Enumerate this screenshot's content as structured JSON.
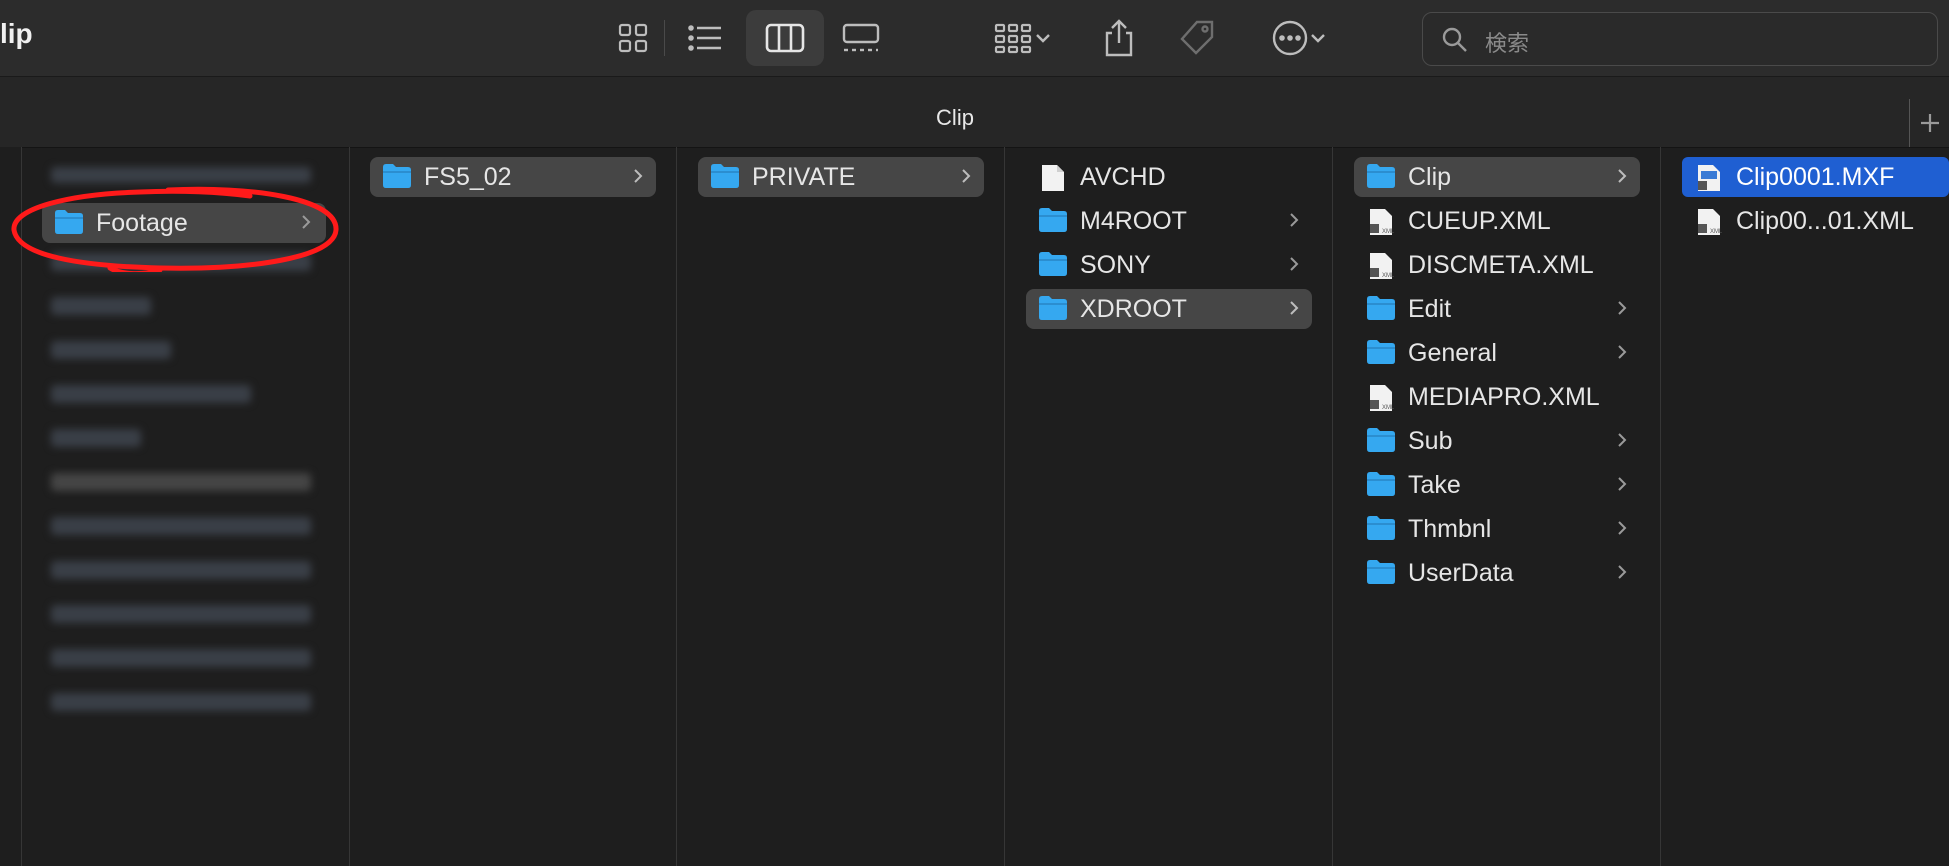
{
  "window": {
    "title": "lip"
  },
  "toolbar": {
    "view_icons": [
      "icon-view-grid",
      "icon-view-list",
      "icon-view-columns",
      "icon-view-gallery"
    ],
    "active_view": "columns",
    "search_placeholder": "検索"
  },
  "tab": {
    "title": "Clip"
  },
  "colors": {
    "selection": "#1f5fd2",
    "folder": "#35a8f0",
    "annotation": "#ff1a1a"
  },
  "sidebar": {
    "highlighted_item": "Footage"
  },
  "columns": [
    {
      "items": [
        {
          "label": "FS5_02",
          "type": "folder",
          "selected": true
        }
      ]
    },
    {
      "items": [
        {
          "label": "PRIVATE",
          "type": "folder",
          "selected": true
        }
      ]
    },
    {
      "items": [
        {
          "label": "AVCHD",
          "type": "file"
        },
        {
          "label": "M4ROOT",
          "type": "folder"
        },
        {
          "label": "SONY",
          "type": "folder"
        },
        {
          "label": "XDROOT",
          "type": "folder",
          "selected": true
        }
      ]
    },
    {
      "items": [
        {
          "label": "Clip",
          "type": "folder",
          "selected": true
        },
        {
          "label": "CUEUP.XML",
          "type": "xml"
        },
        {
          "label": "DISCMETA.XML",
          "type": "xml"
        },
        {
          "label": "Edit",
          "type": "folder"
        },
        {
          "label": "General",
          "type": "folder"
        },
        {
          "label": "MEDIAPRO.XML",
          "type": "xml"
        },
        {
          "label": "Sub",
          "type": "folder"
        },
        {
          "label": "Take",
          "type": "folder"
        },
        {
          "label": "Thmbnl",
          "type": "folder"
        },
        {
          "label": "UserData",
          "type": "folder"
        }
      ]
    },
    {
      "items": [
        {
          "label": "Clip0001.MXF",
          "type": "mxf",
          "focused": true
        },
        {
          "label": "Clip00...01.XML",
          "type": "xml"
        }
      ]
    }
  ]
}
